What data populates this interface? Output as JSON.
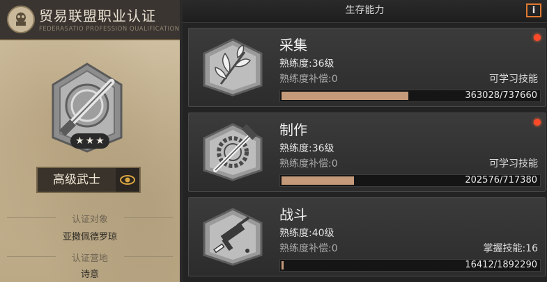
{
  "certificate": {
    "title": "贸易联盟职业认证",
    "subtitle": "FEDERASATIO PROFESSION QUALIFICATION",
    "stars": 3,
    "rank": "高级武士",
    "target_label": "认证对象",
    "target_value": "亚撒佩德罗琼",
    "base_label": "认证营地",
    "base_value": "诗意"
  },
  "panel": {
    "title": "生存能力",
    "info_icon": "i"
  },
  "skills": [
    {
      "name": "采集",
      "icon": "leaves-icon",
      "proficiency": "熟练度:36级",
      "compensation": "熟练度补偿:0",
      "skill_status": "可学习技能",
      "progress": "363028/737660",
      "current": 363028,
      "max": 737660,
      "alert": true
    },
    {
      "name": "制作",
      "icon": "hammer-wrench-gear-icon",
      "proficiency": "熟练度:36级",
      "compensation": "熟练度补偿:0",
      "skill_status": "可学习技能",
      "progress": "202576/717380",
      "current": 202576,
      "max": 717380,
      "alert": true
    },
    {
      "name": "战斗",
      "icon": "submachine-gun-icon",
      "proficiency": "熟练度:40级",
      "compensation": "熟练度补偿:0",
      "skill_status": "掌握技能:16",
      "progress": "16412/1892290",
      "current": 16412,
      "max": 1892290,
      "alert": false
    }
  ],
  "colors": {
    "bar_fill": "#c49a7a",
    "alert_dot": "#ff4a2a",
    "info_border": "#e07a30",
    "paper": "#c9b99a"
  }
}
